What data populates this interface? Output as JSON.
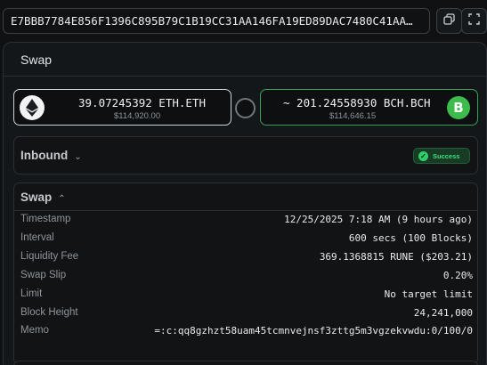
{
  "tx_hash": "E7BBB7784E856F1396C895B79C1B19CC31AA146FA19ED89DAC7480C41AA…",
  "icons": {
    "copy": "copy-icon",
    "expand": "expand-icon",
    "eth": "eth-logo-icon",
    "bch": "bch-logo-icon"
  },
  "card": {
    "title": "Swap"
  },
  "from_asset": {
    "amount": "39.07245392 ETH.ETH",
    "usd": "$114,920.00"
  },
  "to_asset": {
    "amount": "~ 201.24558930 BCH.BCH",
    "usd": "$114,646.15",
    "logo_glyph": "B"
  },
  "inbound": {
    "title": "Inbound",
    "status": "Success"
  },
  "swap": {
    "title": "Swap",
    "rows": [
      {
        "label": "Timestamp",
        "value": "12/25/2025 7:18 AM (9 hours ago)"
      },
      {
        "label": "Interval",
        "value": "600 secs (100 Blocks)"
      },
      {
        "label": "Liquidity Fee",
        "value": "369.1368815 RUNE ($203.21)"
      },
      {
        "label": "Swap Slip",
        "value": "0.20%"
      },
      {
        "label": "Limit",
        "value": "No target limit"
      },
      {
        "label": "Block Height",
        "value": "24,241,000"
      },
      {
        "label": "Memo",
        "value": "=:c:qq8gzhzt58uam45tcmnvejnsf3zttg5m3vgzekvwdu:0/100/0"
      }
    ]
  },
  "colors": {
    "success": "#3ee07c",
    "bch": "#3dbb4d",
    "out_border": "#35a155"
  }
}
